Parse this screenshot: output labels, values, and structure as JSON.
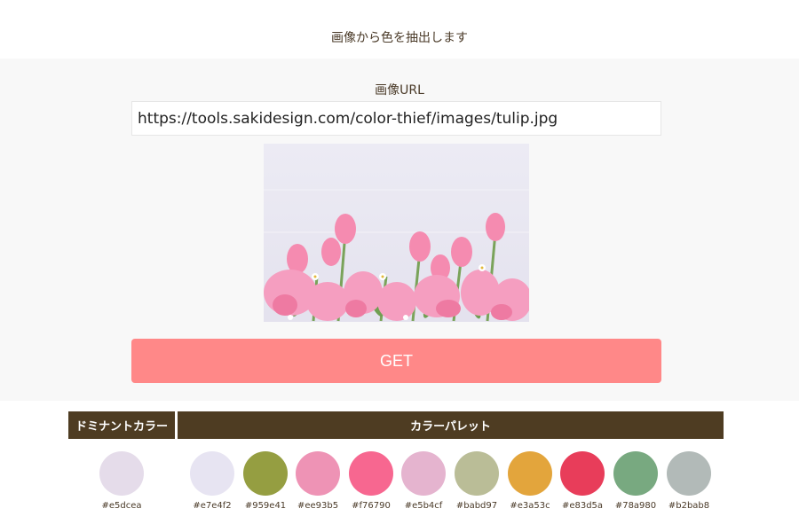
{
  "header": {
    "title": "画像から色を抽出します"
  },
  "form": {
    "url_label": "画像URL",
    "url_value": "https://tools.sakidesign.com/color-thief/images/tulip.jpg",
    "submit_label": "GET"
  },
  "results": {
    "dominant_heading": "ドミナントカラー",
    "palette_heading": "カラーパレット",
    "dominant": {
      "hex": "#e5dcea",
      "color": "#e5dcea"
    },
    "palette": [
      {
        "hex": "#e7e4f2",
        "color": "#e7e4f2"
      },
      {
        "hex": "#959e41",
        "color": "#959e41"
      },
      {
        "hex": "#ee93b5",
        "color": "#ee93b5"
      },
      {
        "hex": "#f76790",
        "color": "#f76790"
      },
      {
        "hex": "#e5b4cf",
        "color": "#e5b4cf"
      },
      {
        "hex": "#babd97",
        "color": "#babd97"
      },
      {
        "hex": "#e3a53c",
        "color": "#e3a53c"
      },
      {
        "hex": "#e83d5a",
        "color": "#e83d5a"
      },
      {
        "hex": "#78a980",
        "color": "#78a980"
      },
      {
        "hex": "#b2bab8",
        "color": "#b2bab8"
      }
    ]
  },
  "colors": {
    "heading_bg": "#4e3c22",
    "button_bg": "#ff8888",
    "panel_bg": "#f8f8f8"
  }
}
